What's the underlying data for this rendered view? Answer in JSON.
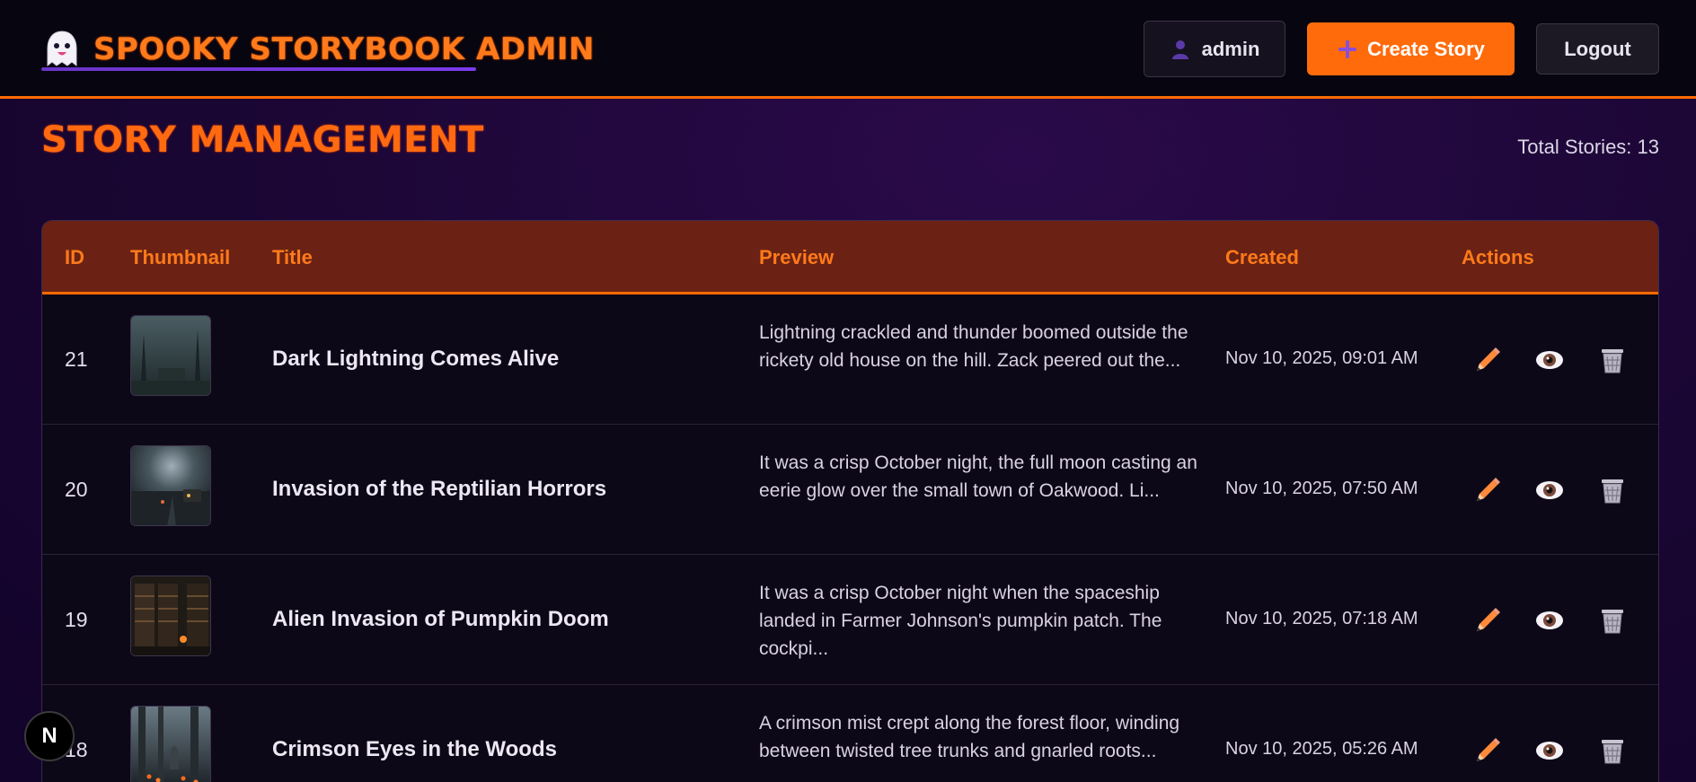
{
  "header": {
    "brand_title": "SPOOKY STORYBOOK ADMIN",
    "user_label": "admin",
    "create_label": "Create Story",
    "logout_label": "Logout"
  },
  "page": {
    "title": "STORY MANAGEMENT",
    "total_label": "Total Stories: 13"
  },
  "table": {
    "columns": [
      "ID",
      "Thumbnail",
      "Title",
      "Preview",
      "Created",
      "Actions"
    ],
    "rows": [
      {
        "id": "21",
        "title": "Dark Lightning Comes Alive",
        "preview": "Lightning crackled and thunder boomed outside the rickety old house on the hill. Zack peered out the...",
        "created": "Nov 10, 2025, 09:01 AM"
      },
      {
        "id": "20",
        "title": "Invasion of the Reptilian Horrors",
        "preview": "It was a crisp October night, the full moon casting an eerie glow over the small town of Oakwood. Li...",
        "created": "Nov 10, 2025, 07:50 AM"
      },
      {
        "id": "19",
        "title": "Alien Invasion of Pumpkin Doom",
        "preview": "It was a crisp October night when the spaceship landed in Farmer Johnson's pumpkin patch. The cockpi...",
        "created": "Nov 10, 2025, 07:18 AM"
      },
      {
        "id": "18",
        "title": "Crimson Eyes in the Woods",
        "preview": "A crimson mist crept along the forest floor, winding between twisted tree trunks and gnarled roots...",
        "created": "Nov 10, 2025, 05:26 AM"
      }
    ]
  },
  "badge": {
    "label": "N"
  },
  "colors": {
    "accent": "#ff6b0a",
    "header_bg": "#07050f",
    "table_head_bg": "#6b2214",
    "purple": "#6a35c8"
  },
  "icons": {
    "brand": "ghost-icon",
    "user": "user-icon",
    "create": "plus-icon",
    "edit": "pencil-icon",
    "view": "eye-icon",
    "delete": "trash-icon"
  }
}
